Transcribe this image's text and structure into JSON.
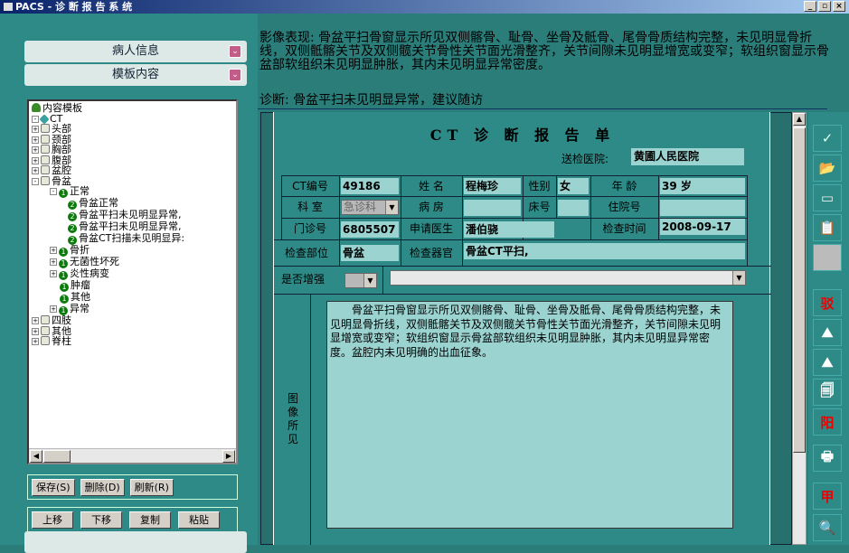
{
  "window": {
    "title": "PACS - 诊 断 报 告 系 统",
    "btn_min": "_",
    "btn_max": "▫",
    "btn_close": "×"
  },
  "left": {
    "panel1": "病人信息",
    "panel2": "模板内容",
    "tree": {
      "root": "内容模板",
      "ct": "CT",
      "n1": "头部",
      "n2": "颈部",
      "n3": "胸部",
      "n4": "腹部",
      "n5": "盆腔",
      "n6": "骨盆",
      "n7": "正常",
      "n8": "骨盆正常",
      "n9": "骨盆平扫未见明显异常,",
      "n10": "骨盆平扫未见明显异常,",
      "n11": "骨盆CT扫描未见明显异:",
      "n12": "骨折",
      "n13": "无菌性坏死",
      "n14": "炎性病变",
      "n15": "肿瘤",
      "n16": "其他",
      "n17": "异常",
      "n18": "四肢",
      "n19": "其他",
      "n20": "脊柱"
    },
    "buttons1": [
      "保存(S)",
      "删除(D)",
      "刷新(R)"
    ],
    "buttons2": [
      "上移",
      "下移",
      "复制",
      "粘贴"
    ]
  },
  "findings": "影像表现: 骨盆平扫骨窗显示所见双侧髂骨、耻骨、坐骨及骶骨、尾骨骨质结构完整，未见明显骨折线，双侧骶髂关节及双侧髋关节骨性关节面光滑整齐，关节间隙未见明显增宽或变窄；软组织窗显示骨盆部软组织未见明显肿胀，其内未见明显异常密度。",
  "diagnosis": "诊断:   骨盆平扫未见明显异常，建议随访",
  "report": {
    "title": "CT 诊 断 报 告 单",
    "hospital_label": "送检医院:",
    "hospital": "黄圃人民医院",
    "ct_no_label": "CT编号",
    "ct_no": "49186",
    "name_label": "姓 名",
    "name": "程梅珍",
    "sex_label": "性别",
    "sex": "女",
    "age_label": "年 龄",
    "age": "39 岁",
    "dept_label": "科 室",
    "dept": "急诊科",
    "ward_label": "病 房",
    "bed_label": "床号",
    "inpatient_label": "住院号",
    "outpatient_label": "门诊号",
    "outpatient": "6805507",
    "doctor_label": "申请医生",
    "doctor": "潘伯骁",
    "exam_time_label": "检查时间",
    "exam_time": "2008-09-17",
    "part_label": "检查部位",
    "part": "骨盆",
    "organ_label": "检查器官",
    "organ": "骨盆CT平扫,",
    "enhance_label": "是否增强",
    "findings_label": "图像所见",
    "findings_text": "骨盆平扫骨窗显示所见双侧髂骨、耻骨、坐骨及骶骨、尾骨骨质结构完整，未见明显骨折线，双侧骶髂关节及双侧髋关节骨性关节面光滑整齐，关节间隙未见明显增宽或变窄；软组织窗显示骨盆部软组织未见明显肿胀，其内未见明显异常密度。盆腔内未见明确的出血征象。"
  },
  "toolbar": {
    "t1": "驳",
    "t2": "阳",
    "t3": "甲"
  }
}
